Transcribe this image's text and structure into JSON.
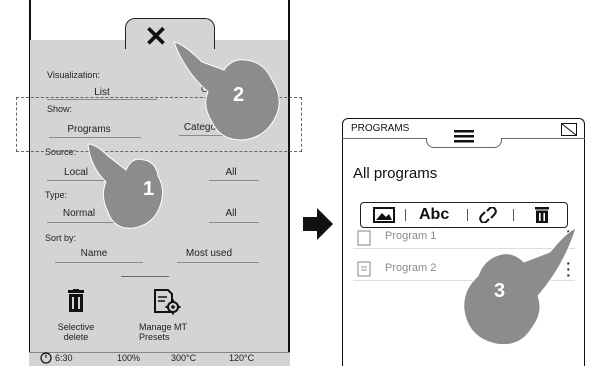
{
  "left_panel": {
    "close_glyph": "✕",
    "visualization": {
      "label": "Visualization:",
      "options": [
        "List",
        "Gri"
      ]
    },
    "show": {
      "label": "Show:",
      "options": [
        "Programs",
        "Categories"
      ]
    },
    "source": {
      "label": "Source:",
      "options": [
        "Local",
        "All"
      ]
    },
    "type": {
      "label": "Type:",
      "options": [
        "Normal",
        "All"
      ]
    },
    "sort_by": {
      "label": "Sort by:",
      "options": [
        "Name",
        "Most used"
      ]
    },
    "tools": {
      "selective_delete": "Selective\ndelete",
      "manage_mt_presets": "Manage MT\nPresets"
    },
    "status_bar": {
      "clock": "6:30",
      "pct": "100%",
      "temp1": "300°C",
      "temp2": "120°C"
    }
  },
  "right_panel": {
    "header_title": "PROGRAMS",
    "heading": "All programs",
    "toolbar": {
      "text_button": "Abc"
    },
    "programs": [
      {
        "label": "Program 1"
      },
      {
        "label": "Program 2"
      }
    ]
  },
  "callouts": [
    "1",
    "2",
    "3"
  ],
  "colors": {
    "panel_gray": "#d4d4d4",
    "hand_gray": "#8c8c8c",
    "ink": "#111111"
  }
}
